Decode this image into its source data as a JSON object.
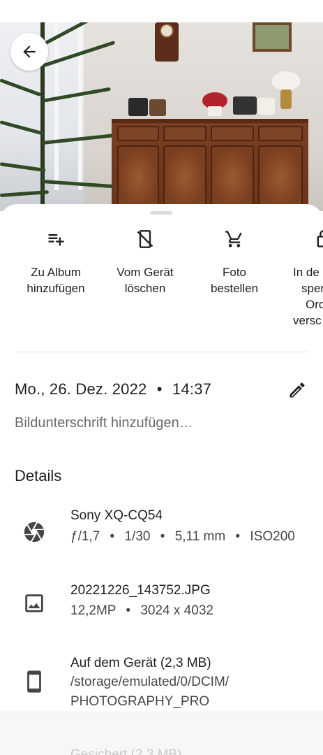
{
  "actions": [
    {
      "label": "Zu Album hinzufügen",
      "line1": "Zu Album",
      "line2": "hinzufügen",
      "icon": "playlist-add-icon"
    },
    {
      "label": "Vom Gerät löschen",
      "line1": "Vom Gerät",
      "line2": "löschen",
      "icon": "phone-delete-icon"
    },
    {
      "label": "Foto bestellen",
      "line1": "Foto",
      "line2": "bestellen",
      "icon": "shopping-cart-icon"
    },
    {
      "label": "In de sper Orc versc",
      "line1": "In de",
      "line2": "sper",
      "line3": "Orc",
      "line4": "versc",
      "icon": "lock-icon"
    }
  ],
  "info": {
    "date": "Mo., 26. Dez. 2022",
    "separator": "•",
    "time": "14:37",
    "caption_placeholder": "Bildunterschrift hinzufügen…"
  },
  "details": {
    "title": "Details",
    "camera": {
      "model": "Sony XQ-CQ54",
      "aperture": "ƒ/1,7",
      "shutter": "1/30",
      "focal": "5,11 mm",
      "iso": "ISO200"
    },
    "file": {
      "name": "20221226_143752.JPG",
      "megapixels": "12,2MP",
      "resolution": "3024 x 4032"
    },
    "storage": {
      "title": "Auf dem Gerät (2,3 MB)",
      "path_line1": "/storage/emulated/0/DCIM/",
      "path_line2": "PHOTOGRAPHY_PRO"
    },
    "backup_partial": "Gesichert (2,3 MB)"
  },
  "colors": {
    "text": "#1f1f1f",
    "secondary": "#444746",
    "placeholder": "#6a6a6a",
    "divider": "#dcdcdc"
  }
}
